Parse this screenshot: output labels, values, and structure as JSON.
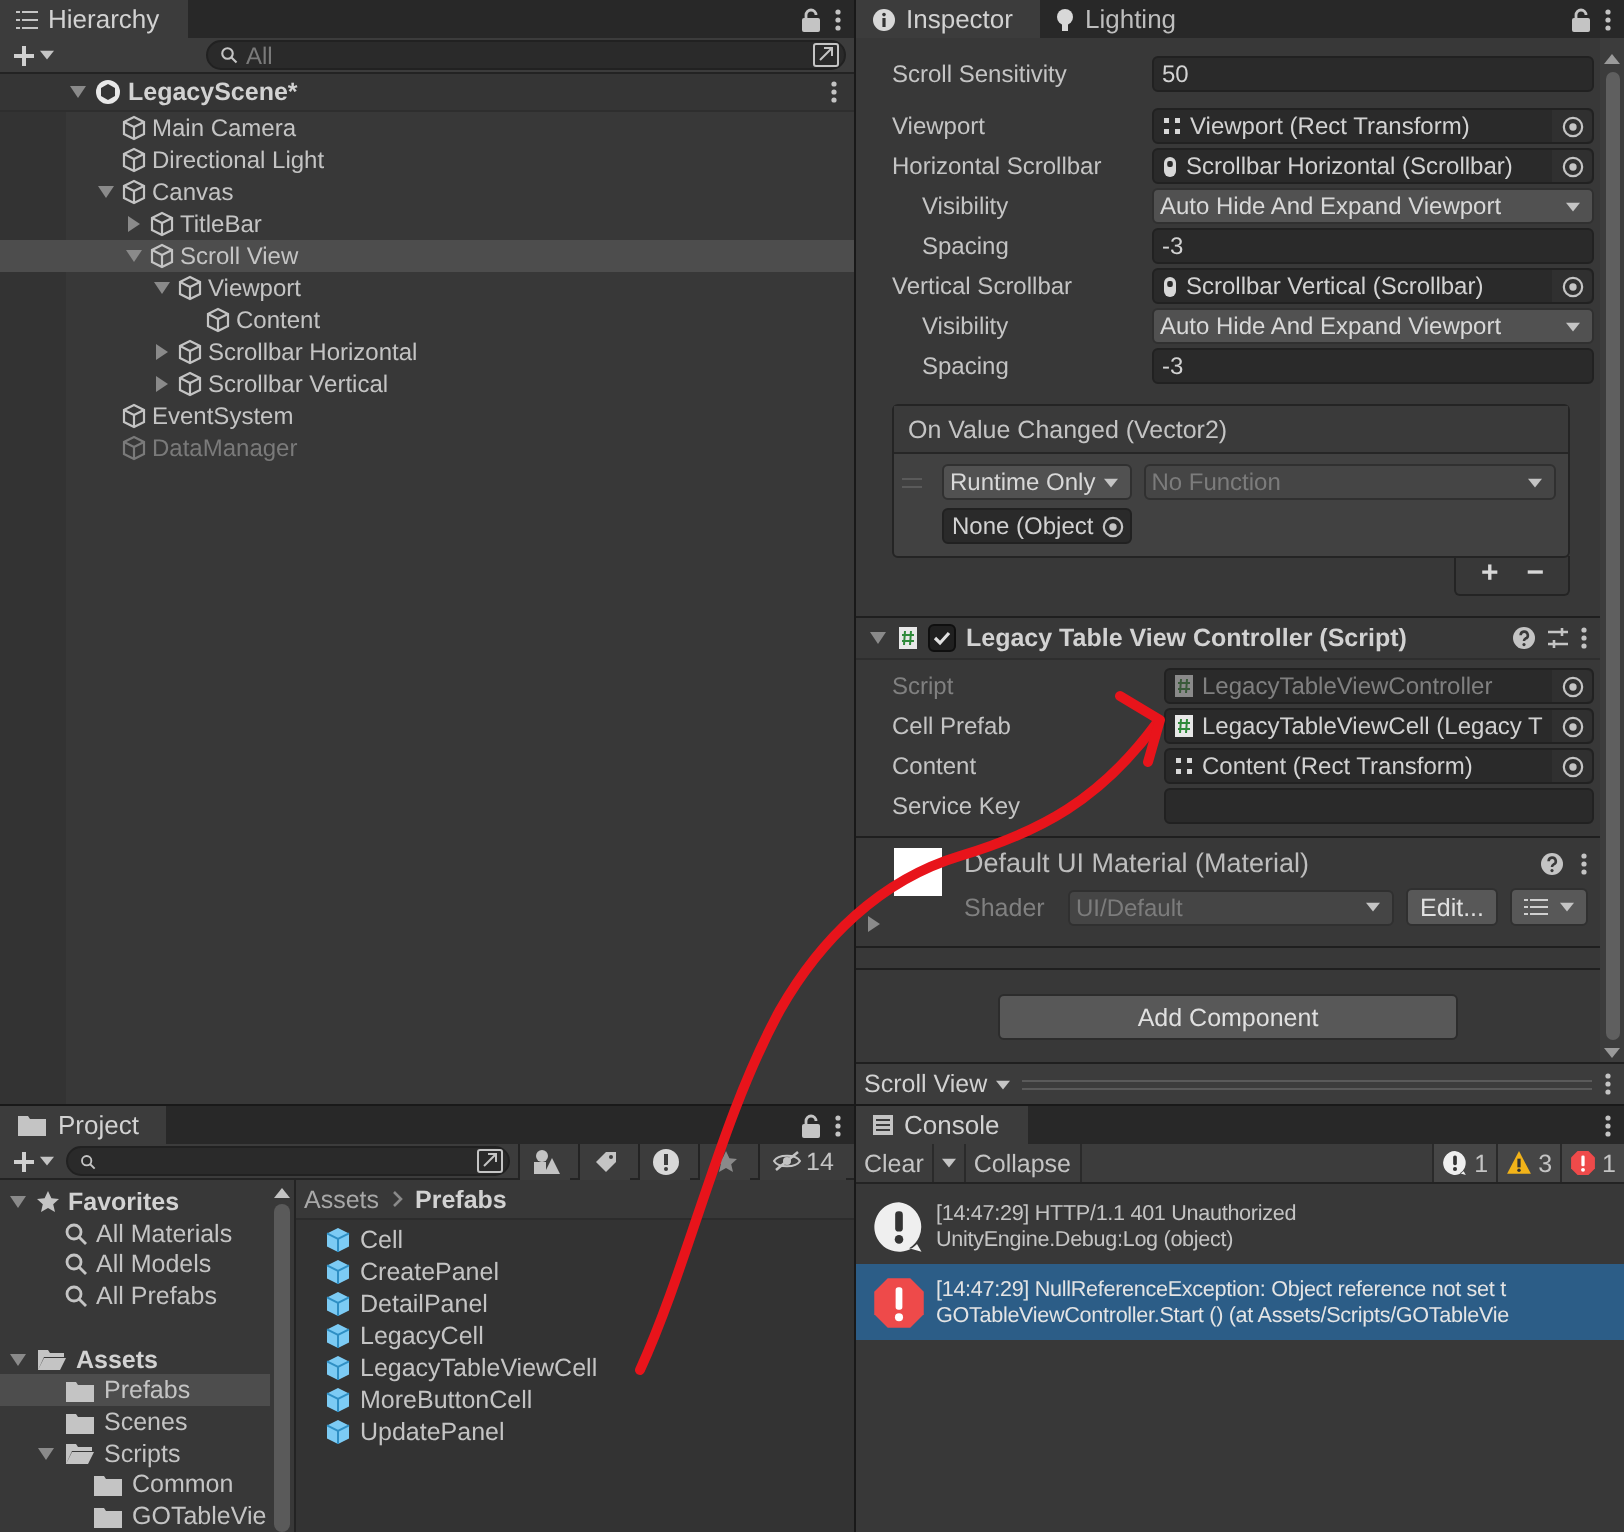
{
  "hierarchy": {
    "tabs": [
      {
        "label": "Hierarchy",
        "selected": true
      }
    ],
    "search": {
      "placeholder": "All"
    },
    "scene": {
      "name": "LegacyScene*",
      "expanded": true
    },
    "items": [
      {
        "name": "Main Camera",
        "selected": false,
        "active": true
      },
      {
        "name": "Directional Light",
        "selected": false,
        "active": true
      },
      {
        "name": "Canvas",
        "selected": false,
        "active": true,
        "expanded": true,
        "children": [
          {
            "name": "TitleBar",
            "selected": false,
            "active": true,
            "expanded": false
          },
          {
            "name": "Scroll View",
            "selected": true,
            "active": true,
            "expanded": true,
            "children": [
              {
                "name": "Viewport",
                "selected": false,
                "active": true,
                "expanded": true,
                "children": [
                  {
                    "name": "Content",
                    "selected": false,
                    "active": true
                  }
                ]
              },
              {
                "name": "Scrollbar Horizontal",
                "selected": false,
                "active": true,
                "expanded": false
              },
              {
                "name": "Scrollbar Vertical",
                "selected": false,
                "active": true,
                "expanded": false
              }
            ]
          }
        ]
      },
      {
        "name": "EventSystem",
        "selected": false,
        "active": true
      },
      {
        "name": "DataManager",
        "selected": false,
        "active": false
      }
    ]
  },
  "inspector": {
    "tabs": [
      {
        "label": "Inspector",
        "selected": true
      },
      {
        "label": "Lighting",
        "selected": false
      }
    ],
    "field_groups": [
      [
        {
          "kind": "number",
          "label": "Scroll Sensitivity",
          "value": "50"
        }
      ],
      [
        {
          "kind": "transform-ref",
          "label": "Viewport",
          "value": "Viewport (Rect Transform)"
        },
        {
          "kind": "scrollbar-ref",
          "label": "Horizontal Scrollbar",
          "value": "Scrollbar Horizontal (Scrollbar)",
          "children": [
            {
              "kind": "dropdown",
              "label": "Visibility",
              "value": "Auto Hide And Expand Viewport"
            },
            {
              "kind": "number",
              "label": "Spacing",
              "value": "-3"
            }
          ]
        },
        {
          "kind": "scrollbar-ref",
          "label": "Vertical Scrollbar",
          "value": "Scrollbar Vertical (Scrollbar)",
          "children": [
            {
              "kind": "dropdown",
              "label": "Visibility",
              "value": "Auto Hide And Expand Viewport"
            },
            {
              "kind": "number",
              "label": "Spacing",
              "value": "-3"
            }
          ]
        }
      ]
    ],
    "event": {
      "title": "On Value Changed (Vector2)",
      "mode": {
        "value": "Runtime Only",
        "disabled": false
      },
      "function": {
        "value": "No Function",
        "disabled": true
      },
      "target": "None (Object",
      "buttons": [
        "+",
        "−"
      ]
    },
    "component": {
      "title": "Legacy Table View Controller (Script)",
      "enabled": true,
      "expanded": true,
      "fields": [
        {
          "kind": "script-ref",
          "label": "Script",
          "value": "LegacyTableViewController",
          "disabled": true
        },
        {
          "kind": "script-ref",
          "label": "Cell Prefab",
          "value": "LegacyTableViewCell (Legacy T",
          "disabled": false
        },
        {
          "kind": "transform-ref",
          "label": "Content",
          "value": "Content (Rect Transform)",
          "disabled": false
        },
        {
          "kind": "text",
          "label": "Service Key",
          "disabled": false
        }
      ]
    },
    "material": {
      "title": "Default UI Material (Material)",
      "expanded": false,
      "shader_label": "Shader",
      "shader": "UI/Default",
      "edit_button": "Edit..."
    },
    "add_component": "Add Component",
    "footer": {
      "selection": "Scroll View"
    }
  },
  "project": {
    "tabs": [
      {
        "label": "Project",
        "selected": true
      }
    ],
    "hidden_count": "14",
    "favorites": {
      "label": "Favorites",
      "expanded": true,
      "items": [
        "All Materials",
        "All Models",
        "All Prefabs"
      ]
    },
    "assets": {
      "label": "Assets",
      "expanded": true,
      "children": [
        {
          "name": "Prefabs",
          "selected": true
        },
        {
          "name": "Scenes",
          "selected": false
        },
        {
          "name": "Scripts",
          "selected": false,
          "expanded": true,
          "children": [
            {
              "name": "Common",
              "selected": false
            },
            {
              "name": "GOTableVie",
              "selected": false
            }
          ]
        }
      ]
    },
    "breadcrumb": [
      "Assets",
      "Prefabs"
    ],
    "files": [
      "Cell",
      "CreatePanel",
      "DetailPanel",
      "LegacyCell",
      "LegacyTableViewCell",
      "MoreButtonCell",
      "UpdatePanel"
    ]
  },
  "console": {
    "tabs": [
      {
        "label": "Console",
        "selected": true
      }
    ],
    "clear": "Clear",
    "collapse": "Collapse",
    "counts": [
      {
        "kind": "info",
        "count": "1"
      },
      {
        "kind": "warning",
        "count": "3"
      },
      {
        "kind": "error",
        "count": "1"
      }
    ],
    "entries": [
      {
        "kind": "info",
        "selected": false,
        "lines": [
          "[14:47:29] HTTP/1.1 401 Unauthorized",
          "UnityEngine.Debug:Log (object)"
        ]
      },
      {
        "kind": "error",
        "selected": true,
        "lines": [
          "[14:47:29] NullReferenceException: Object reference not set t",
          "GOTableViewController.Start () (at Assets/Scripts/GOTableVie"
        ]
      }
    ]
  }
}
